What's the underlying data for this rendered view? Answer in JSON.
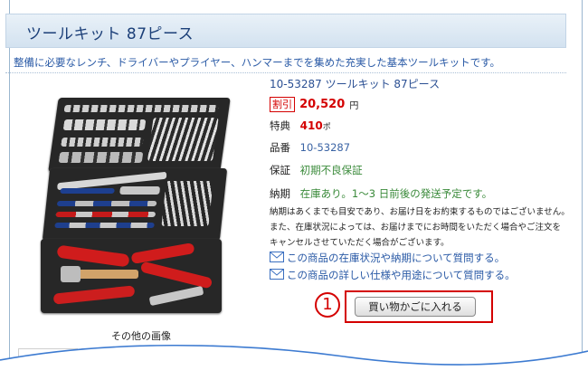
{
  "header": {
    "title": "ツールキット 87ピース"
  },
  "description": "整備に必要なレンチ、ドライバーやプライヤー、ハンマーまでを集めた充実した基本ツールキットです。",
  "product": {
    "name": "10-53287 ツールキット 87ピース",
    "price_badge": "割引",
    "price": "20,520",
    "price_unit": "円",
    "bonus_label": "特典",
    "bonus_value": "410",
    "bonus_unit": "ポ",
    "number_label": "品番",
    "number_value": "10-53287",
    "warranty_label": "保証",
    "warranty_value": "初期不良保証",
    "delivery_label": "納期",
    "delivery_value": "在庫あり。1～3 日前後の発送予定です。"
  },
  "delivery_note": [
    "納期はあくまでも目安であり、お届け日をお約束するものではございません。",
    "また、在庫状況によっては、お届けまでにお時間をいただく場合やご注文を",
    "キャンセルさせていただく場合がございます。"
  ],
  "links": {
    "stock_question": "この商品の在庫状況や納期について質問する。",
    "spec_question": "この商品の詳しい仕様や用途について質問する。"
  },
  "annotation": {
    "step_number": "1"
  },
  "cart": {
    "button_label": "買い物かごに入れる"
  },
  "gallery": {
    "label": "その他の画像"
  },
  "icons": {
    "mail": "mail-icon"
  },
  "colors": {
    "accent_red": "#d40000",
    "link_blue": "#2a5aa6",
    "title_blue": "#1b3f78",
    "green": "#3a8a3a"
  }
}
